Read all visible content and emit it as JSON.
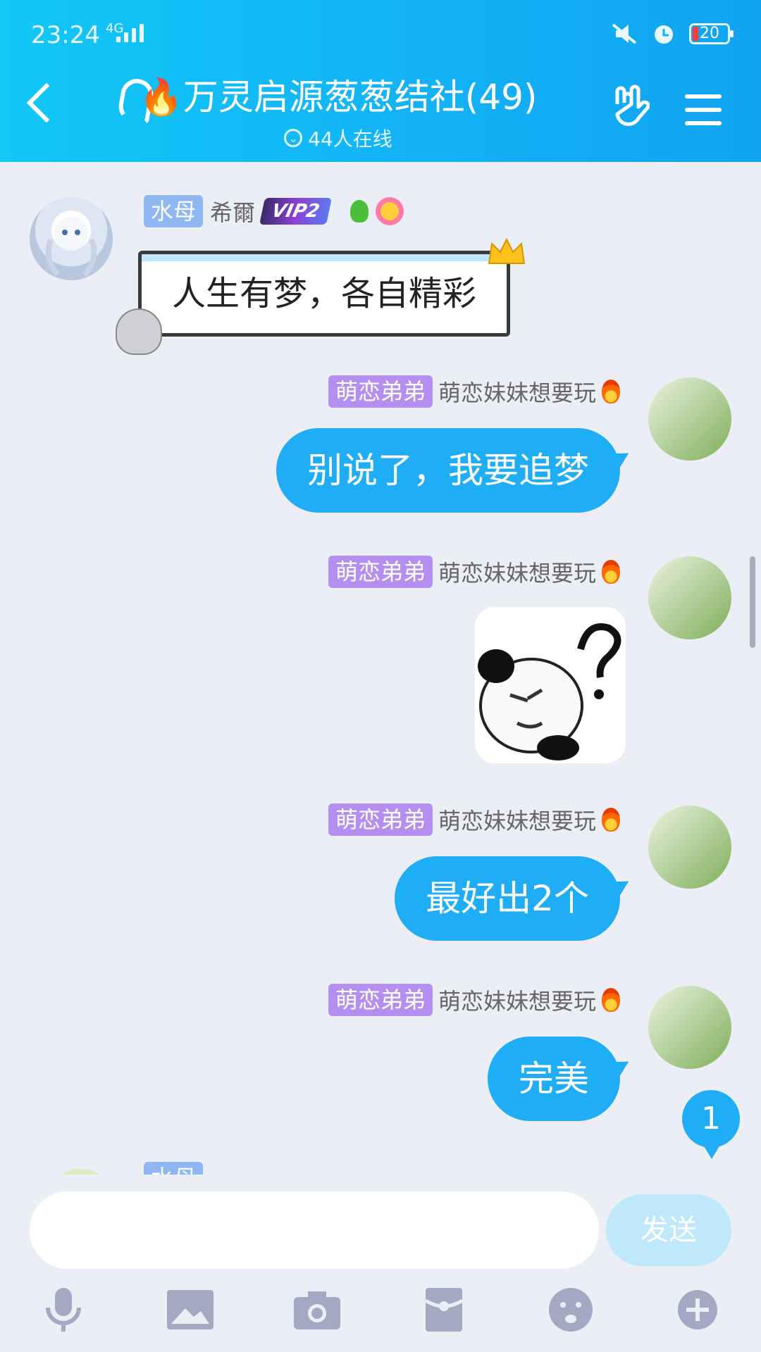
{
  "status": {
    "time": "23:24",
    "network": "4G",
    "battery": "20"
  },
  "header": {
    "title": "🔥万灵启源葱葱结社(49)",
    "online": "44人在线"
  },
  "messages": [
    {
      "side": "left",
      "tag": "水母",
      "name": "希爾",
      "badge": "VIP2",
      "text": "人生有梦，各自精彩"
    },
    {
      "side": "right",
      "tag": "萌恋弟弟",
      "name": "萌恋妹妹想要玩",
      "text": "别说了，我要追梦"
    },
    {
      "side": "right",
      "tag": "萌恋弟弟",
      "name": "萌恋妹妹想要玩",
      "image": "panda-question-sticker"
    },
    {
      "side": "right",
      "tag": "萌恋弟弟",
      "name": "萌恋妹妹想要玩",
      "text": "最好出2个"
    },
    {
      "side": "right",
      "tag": "萌恋弟弟",
      "name": "萌恋妹妹想要玩",
      "text": "完美"
    }
  ],
  "peek": {
    "tag": "水母"
  },
  "unread": "1",
  "input": {
    "placeholder": "",
    "send_label": "发送"
  },
  "toolbar": [
    "microphone-icon",
    "image-icon",
    "camera-icon",
    "red-packet-icon",
    "emoji-icon",
    "plus-icon"
  ],
  "colors": {
    "accent": "#1faef6",
    "tag_blue": "#8fb7f2",
    "tag_purple": "#b48ef0"
  }
}
